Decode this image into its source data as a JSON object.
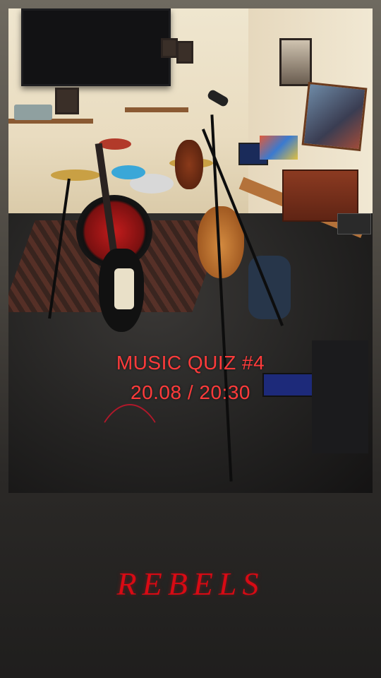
{
  "poster": {
    "event_title": "MUSIC QUIZ #4",
    "event_datetime": "20.08 / 20:30",
    "brand_name": "REBELS"
  },
  "colors": {
    "text_accent": "#ff3b3b",
    "brand_red": "#d80a14",
    "frame_dark": "#1f1e1d"
  }
}
